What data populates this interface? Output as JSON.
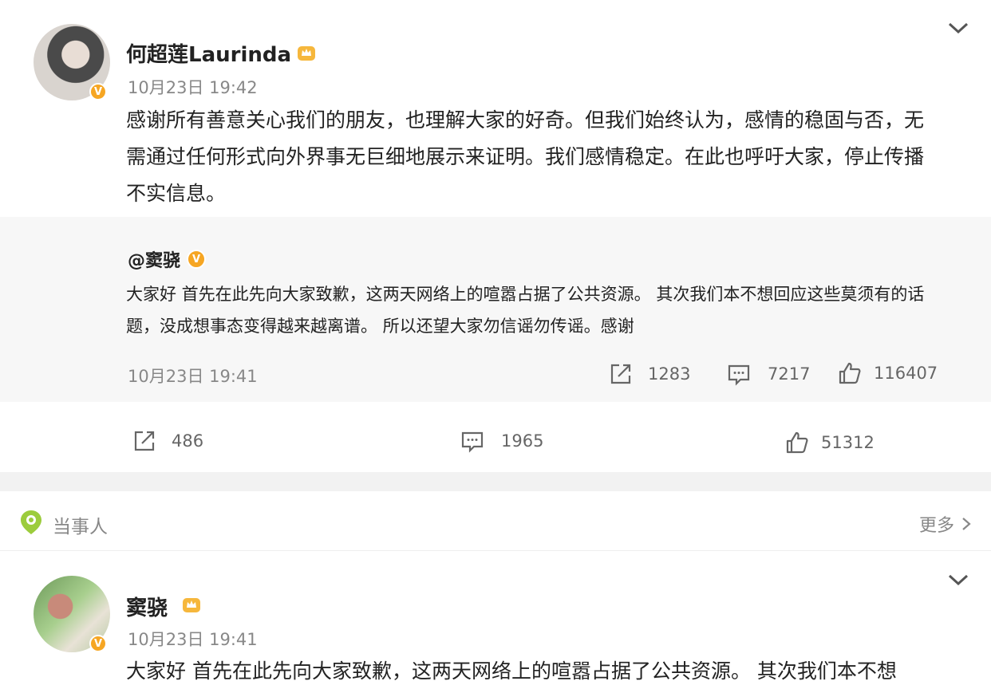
{
  "post1": {
    "author": "何超莲Laurinda",
    "time": "10月23日 19:42",
    "text": "感谢所有善意关心我们的朋友，也理解大家的好奇。但我们始终认为，感情的稳固与否，无需通过任何形式向外界事无巨细地展示来证明。我们感情稳定。在此也呼吁大家，停止传播不实信息。",
    "repost": {
      "author": "@窦骁",
      "text": "大家好 首先在此先向大家致歉，这两天网络上的喧嚣占据了公共资源。 其次我们本不想回应这些莫须有的话题，没成想事态变得越来越离谱。 所以还望大家勿信谣勿传谣。感谢",
      "time": "10月23日 19:41",
      "shares": "1283",
      "comments": "7217",
      "likes": "116407"
    },
    "shares": "486",
    "comments": "1965",
    "likes": "51312"
  },
  "section": {
    "label": "当事人",
    "more": "更多"
  },
  "post2": {
    "author": "窦骁",
    "time": "10月23日 19:41",
    "text": "大家好 首先在此先向大家致歉，这两天网络上的喧嚣占据了公共资源。 其次我们本不想"
  },
  "colors": {
    "verified_badge": "#f6a623",
    "section_icon": "#8bc34a",
    "background": "#f2f2f2"
  },
  "icons": [
    "chevron-down-icon",
    "crown-icon",
    "verified-icon",
    "share-icon",
    "comment-icon",
    "like-icon",
    "map-pin-icon",
    "chevron-right-icon"
  ]
}
